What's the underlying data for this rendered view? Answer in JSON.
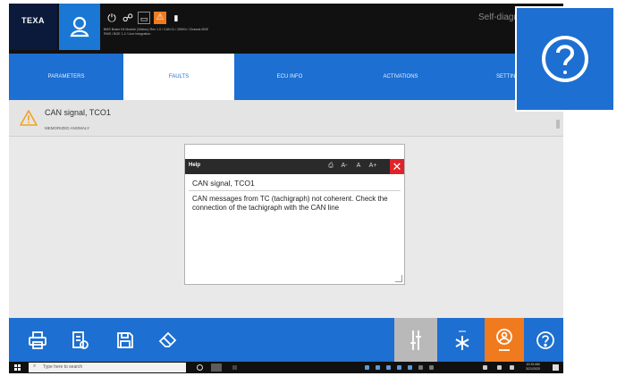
{
  "header": {
    "logo": "TEXA",
    "app_title": "Self-diagnosis",
    "info_line1": "BMS Brake Kit Module (Wabco) Rev 1.0 / CAN 11 / 250Kb / Chassis BGE",
    "info_line2": "RMS / BGE 1.2 / Line Integration"
  },
  "tabs": [
    {
      "label": "Parameters",
      "active": false
    },
    {
      "label": "Faults",
      "active": true
    },
    {
      "label": "ECU info",
      "active": false
    },
    {
      "label": "Activations",
      "active": false
    },
    {
      "label": "Settings",
      "active": false
    }
  ],
  "fault": {
    "title": "CAN signal, TCO1",
    "status": "Memorized anomaly"
  },
  "help": {
    "label": "Help",
    "code": "CAN signal, TCO1",
    "body": "CAN messages from TC (tachigraph) not coherent. Check the connection of the tachigraph with the CAN line"
  },
  "toolbar": {
    "tools": [
      "print-icon",
      "report-icon",
      "save-icon",
      "erase-icon",
      "slider-icon",
      "snapshot-icon",
      "record-icon",
      "help-icon"
    ]
  },
  "taskbar": {
    "search_placeholder": "Type here to search",
    "time": "10:15 AM",
    "date": "3/21/2020"
  },
  "colors": {
    "accent": "#1d6fd1",
    "header": "#111111",
    "alert": "#f07a1e",
    "close": "#e0232a"
  }
}
